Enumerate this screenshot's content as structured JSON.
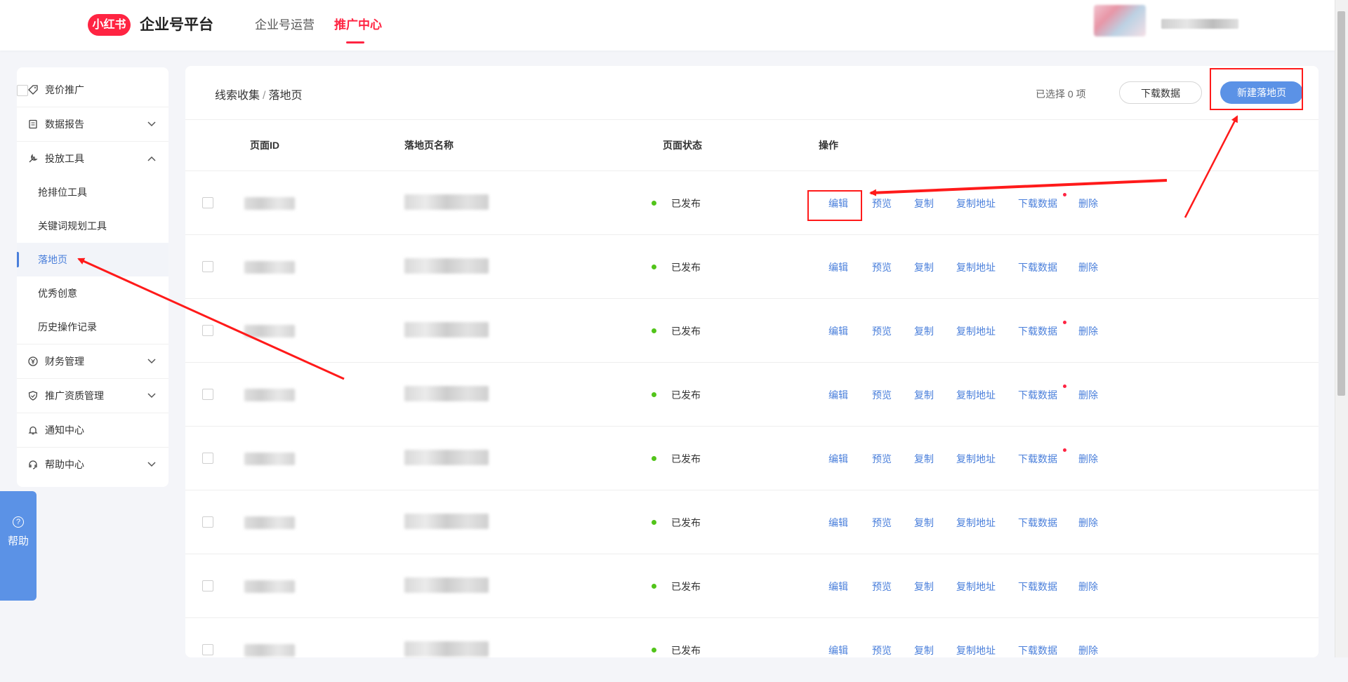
{
  "header": {
    "logo_text": "小红书",
    "platform_title": "企业号平台",
    "nav": [
      "企业号运营",
      "推广中心"
    ],
    "active_nav": "推广中心"
  },
  "sidebar": {
    "items": [
      {
        "label": "竞价推广",
        "icon": "tag-icon",
        "expandable": false
      },
      {
        "label": "数据报告",
        "icon": "report-icon",
        "expandable": true,
        "expanded": false
      },
      {
        "label": "投放工具",
        "icon": "tools-icon",
        "expandable": true,
        "expanded": true
      },
      {
        "label": "财务管理",
        "icon": "yen-icon",
        "expandable": true,
        "expanded": false
      },
      {
        "label": "推广资质管理",
        "icon": "shield-icon",
        "expandable": true,
        "expanded": false
      },
      {
        "label": "通知中心",
        "icon": "bell-icon",
        "expandable": false
      },
      {
        "label": "帮助中心",
        "icon": "headset-icon",
        "expandable": true,
        "expanded": false
      }
    ],
    "sub_items": [
      "抢排位工具",
      "关键词规划工具",
      "落地页",
      "优秀创意",
      "历史操作记录"
    ],
    "active_sub": "落地页"
  },
  "help_float": {
    "label": "帮助"
  },
  "main": {
    "breadcrumb": [
      "线索收集",
      "落地页"
    ],
    "selected_count": "已选择 0 项",
    "download_button": "下载数据",
    "new_button": "新建落地页",
    "columns": [
      "页面ID",
      "落地页名称",
      "页面状态",
      "操作"
    ],
    "actions": [
      "编辑",
      "预览",
      "复制",
      "复制地址",
      "下载数据",
      "删除"
    ],
    "rows": [
      {
        "status": "已发布",
        "download_badge": true
      },
      {
        "status": "已发布",
        "download_badge": false
      },
      {
        "status": "已发布",
        "download_badge": true
      },
      {
        "status": "已发布",
        "download_badge": true
      },
      {
        "status": "已发布",
        "download_badge": true
      },
      {
        "status": "已发布",
        "download_badge": false
      },
      {
        "status": "已发布",
        "download_badge": false
      },
      {
        "status": "已发布",
        "download_badge": false
      }
    ]
  },
  "colors": {
    "brand_red": "#ff2442",
    "accent_blue": "#5b92e6",
    "link_blue": "#4a7fdb",
    "status_green": "#52c41a",
    "annotation_red": "#ff1a1a"
  }
}
